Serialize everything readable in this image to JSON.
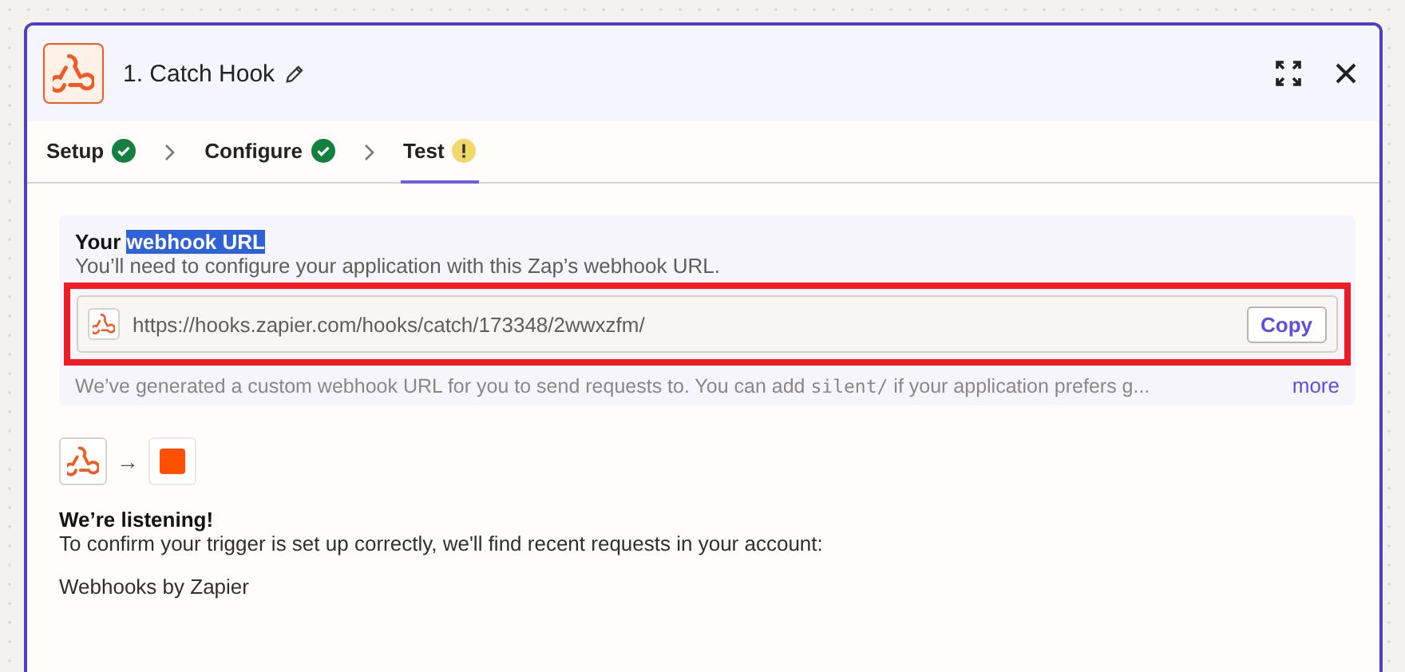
{
  "step": {
    "title": "1. Catch Hook"
  },
  "tabs": [
    {
      "label": "Setup",
      "kind": "done",
      "selected": false
    },
    {
      "label": "Configure",
      "kind": "done",
      "selected": false
    },
    {
      "label": "Test",
      "kind": "warning",
      "selected": true
    }
  ],
  "webhook_section": {
    "title": [
      {
        "text": "Your",
        "highlighted": false
      },
      {
        "text": "webhook URL",
        "highlighted": true
      }
    ],
    "subtitle": "You’ll need to configure your application with this Zap’s webhook URL.",
    "url": "https://hooks.zapier.com/hooks/catch/173348/2wwxzfm/",
    "url_outlined": true,
    "copy_button": "Copy",
    "note": {
      "before": "We’ve generated a custom webhook URL for you to send requests to. You can add ",
      "code": "silent/",
      "after": " if your application prefers g..."
    },
    "more_link": "more"
  },
  "listening": {
    "arrow": "→",
    "title": "We’re listening!",
    "text": "To confirm your trigger is set up correctly, we'll find recent requests in your account:",
    "account": "Webhooks by Zapier"
  }
}
